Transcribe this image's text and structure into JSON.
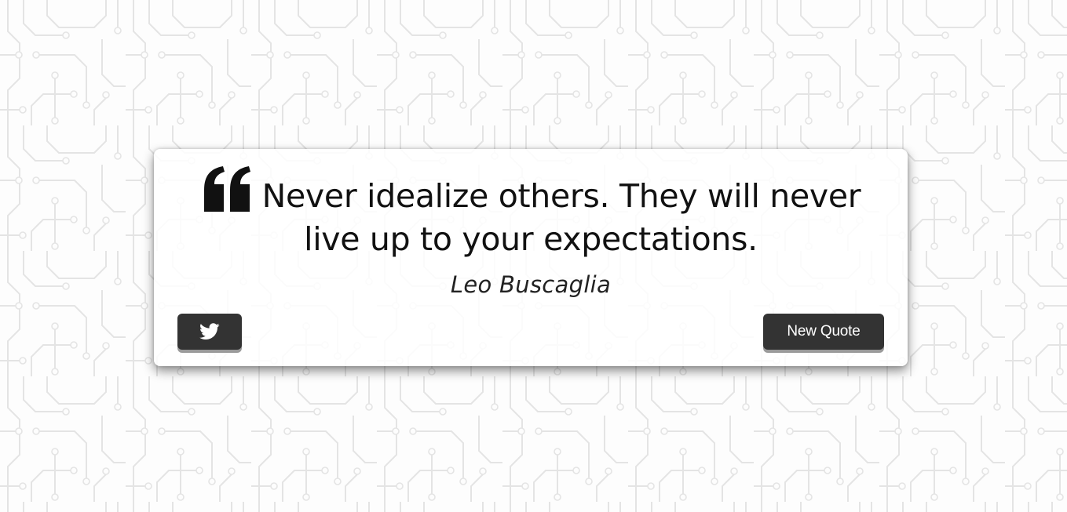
{
  "quote": {
    "text": "Never idealize others. They will never live up to your expectations.",
    "author": "Leo Buscaglia",
    "icon": "quote-left-icon"
  },
  "actions": {
    "tweet_icon": "twitter-icon",
    "new_quote_label": "New Quote"
  },
  "theme": {
    "button_color": "#333333",
    "text_color": "#111111",
    "background_color": "#fdfdfd"
  }
}
